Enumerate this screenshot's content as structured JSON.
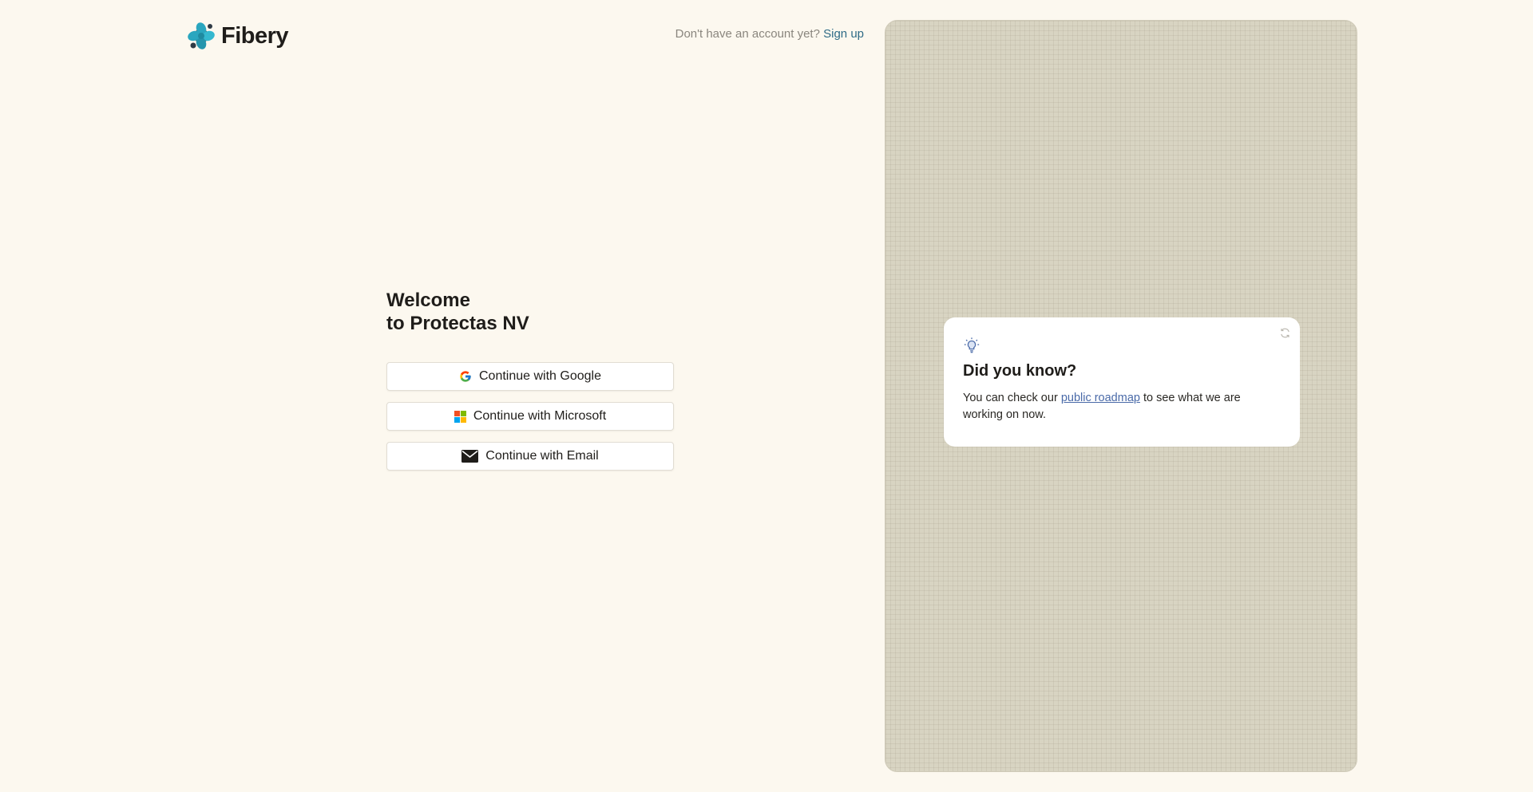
{
  "brand": {
    "name": "Fibery",
    "icon": "fibery-logo-icon",
    "colors": {
      "primary": "#2aa6bf",
      "dark": "#3c4a58"
    }
  },
  "signup": {
    "prompt": "Don't have an account yet?",
    "link_label": "Sign up",
    "link_color": "#2f6b86"
  },
  "welcome": {
    "line1": "Welcome",
    "line2": "to Protectas NV"
  },
  "auth_buttons": [
    {
      "label": "Continue with Google",
      "icon": "google-icon"
    },
    {
      "label": "Continue with Microsoft",
      "icon": "microsoft-icon"
    },
    {
      "label": "Continue with Email",
      "icon": "envelope-icon"
    }
  ],
  "tip": {
    "icon": "lightbulb-icon",
    "title": "Did you know?",
    "text_before": "You can check our",
    "link_label": "public roadmap",
    "text_after": "to see what we are working on now.",
    "refresh_icon": "refresh-icon"
  },
  "panel": {
    "background": "#d8d4c2"
  }
}
